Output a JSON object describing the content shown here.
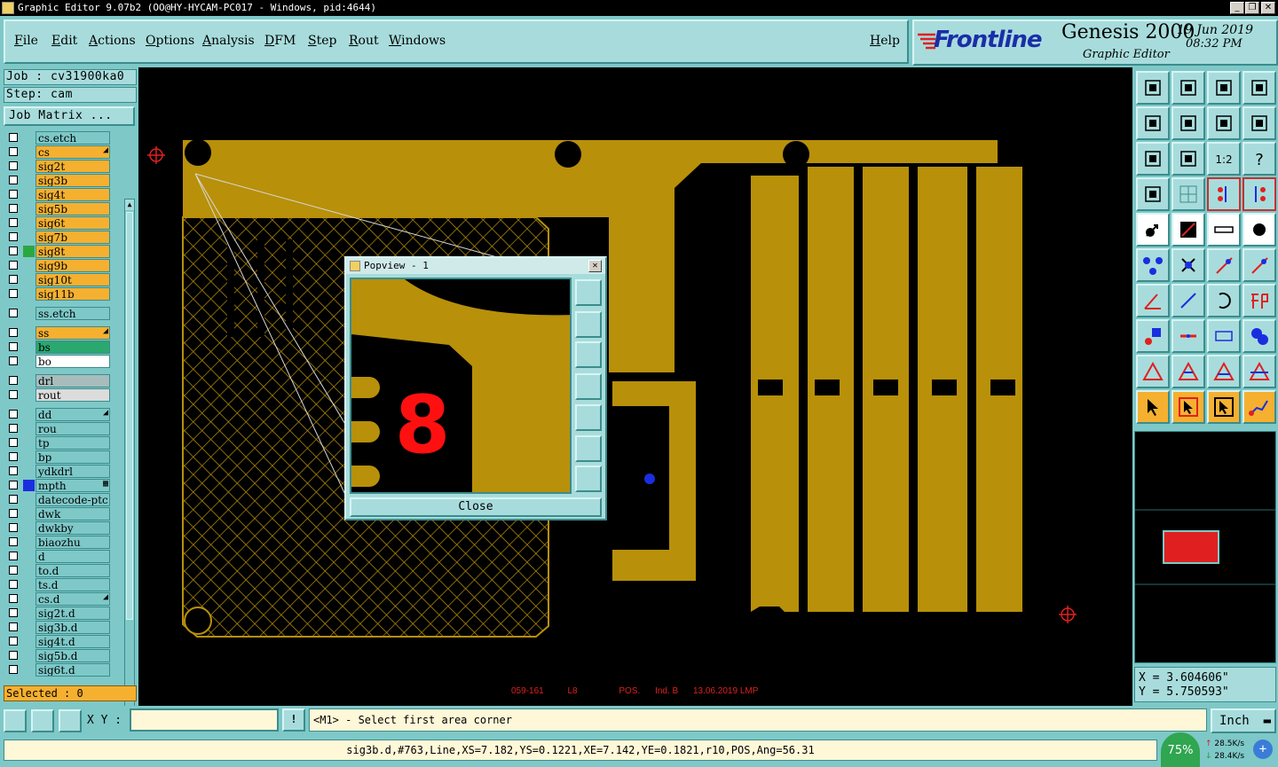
{
  "window": {
    "title": "Graphic Editor 9.07b2 (OO@HY-HYCAM-PC017 - Windows, pid:4644)"
  },
  "menu": {
    "items": [
      "File",
      "Edit",
      "Actions",
      "Options",
      "Analysis",
      "DFM",
      "Step",
      "Rout",
      "Windows"
    ],
    "help": "Help"
  },
  "brand": {
    "logo": "Frontline",
    "product": "Genesis 2000",
    "subtitle": "Graphic Editor",
    "date": "19 Jun 2019",
    "time": "08:32 PM"
  },
  "job": {
    "job_label": "Job : cv31900ka0",
    "step_label": "Step: cam",
    "matrix_button": "Job Matrix ..."
  },
  "layers": [
    {
      "name": "cs.etch",
      "style": "teal"
    },
    {
      "name": "cs",
      "style": "orange",
      "flag": "◢"
    },
    {
      "name": "sig2t",
      "style": "orange"
    },
    {
      "name": "sig3b",
      "style": "orange"
    },
    {
      "name": "sig4t",
      "style": "orange"
    },
    {
      "name": "sig5b",
      "style": "orange"
    },
    {
      "name": "sig6t",
      "style": "orange"
    },
    {
      "name": "sig7b",
      "style": "orange"
    },
    {
      "name": "sig8t",
      "style": "orange",
      "mark": "green"
    },
    {
      "name": "sig9b",
      "style": "orange"
    },
    {
      "name": "sig10t",
      "style": "orange"
    },
    {
      "name": "sig11b",
      "style": "orange"
    },
    {
      "name": "ss.etch",
      "style": "teal",
      "gap": true
    },
    {
      "name": "ss",
      "style": "orange",
      "flag": "◢",
      "gap": true
    },
    {
      "name": "bs",
      "style": "green"
    },
    {
      "name": "bo",
      "style": "white"
    },
    {
      "name": "drl",
      "style": "gray",
      "gap": true
    },
    {
      "name": "rout",
      "style": "lightgray"
    },
    {
      "name": "dd",
      "style": "teal",
      "flag": "◢",
      "gap": true
    },
    {
      "name": "rou",
      "style": "teal"
    },
    {
      "name": "tp",
      "style": "teal"
    },
    {
      "name": "bp",
      "style": "teal"
    },
    {
      "name": "ydkdrl",
      "style": "teal"
    },
    {
      "name": "mpth",
      "style": "teal",
      "mark": "blue",
      "flag": "▦"
    },
    {
      "name": "datecode-ptc",
      "style": "teal"
    },
    {
      "name": "dwk",
      "style": "teal"
    },
    {
      "name": "dwkby",
      "style": "teal"
    },
    {
      "name": "biaozhu",
      "style": "teal"
    },
    {
      "name": "d",
      "style": "teal"
    },
    {
      "name": "to.d",
      "style": "teal"
    },
    {
      "name": "ts.d",
      "style": "teal"
    },
    {
      "name": "cs.d",
      "style": "teal",
      "flag": "◢"
    },
    {
      "name": "sig2t.d",
      "style": "teal"
    },
    {
      "name": "sig3b.d",
      "style": "teal"
    },
    {
      "name": "sig4t.d",
      "style": "teal"
    },
    {
      "name": "sig5b.d",
      "style": "teal"
    },
    {
      "name": "sig6t.d",
      "style": "teal"
    }
  ],
  "selected": "Selected : 0",
  "canvas": {
    "footer": [
      "059-161",
      "L8",
      "POS.",
      "Ind. B",
      "13.06.2019  LMP"
    ]
  },
  "popview": {
    "title": "Popview - 1",
    "number": "8",
    "close_label": "Close"
  },
  "coords": {
    "x": "X = 3.604606\"",
    "y": "Y = 5.750593\""
  },
  "bottom": {
    "xy_label": "X Y :",
    "xy_value": "",
    "warn": "!",
    "prompt": "<M1> - Select first area corner",
    "units": "Inch"
  },
  "status": "sig3b.d,#763,Line,XS=7.182,YS=0.1221,XE=7.142,YE=0.1821,r10,POS,Ang=56.31",
  "net": {
    "percent": "75%",
    "up": "28.5K/s",
    "down": "28.4K/s"
  },
  "colors": {
    "copper": "#b8900a",
    "panel": "#7ec8c8",
    "panel_light": "#a8dcdc",
    "layer_orange": "#f5b030",
    "layer_teal": "#7ec8c8"
  }
}
